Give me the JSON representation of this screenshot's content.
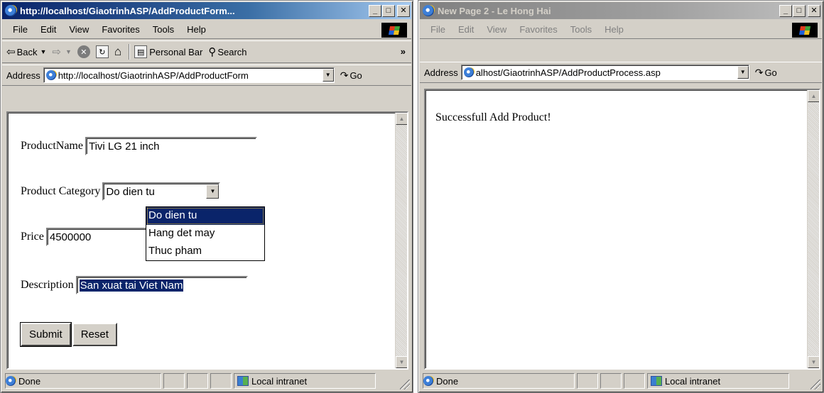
{
  "left_window": {
    "title": "http://localhost/GiaotrinhASP/AddProductForm...",
    "menu": [
      "File",
      "Edit",
      "View",
      "Favorites",
      "Tools",
      "Help"
    ],
    "toolbar": {
      "back_label": "Back",
      "personal_bar_label": "Personal Bar",
      "search_label": "Search"
    },
    "address": {
      "label": "Address",
      "value": "http://localhost/GiaotrinhASP/AddProductForm",
      "go_label": "Go"
    },
    "form": {
      "product_name_label": "ProductName",
      "product_name_value": "Tivi LG 21 inch",
      "category_label": "Product Category",
      "category_selected": "Do dien tu",
      "category_options": [
        "Do dien tu",
        "Hang det may",
        "Thuc pham"
      ],
      "price_label": "Price",
      "price_value": "4500000",
      "description_label": "Description",
      "description_value": "San xuat tai Viet Nam",
      "submit_label": "Submit",
      "reset_label": "Reset"
    },
    "status": {
      "text": "Done",
      "zone": "Local intranet"
    }
  },
  "right_window": {
    "title": "New Page 2 - Le Hong Hai",
    "menu": [
      "File",
      "Edit",
      "View",
      "Favorites",
      "Tools",
      "Help"
    ],
    "address": {
      "label": "Address",
      "value": "alhost/GiaotrinhASP/AddProductProcess.asp",
      "go_label": "Go"
    },
    "content": {
      "message": "Successfull Add Product!"
    },
    "status": {
      "text": "Done",
      "zone": "Local intranet"
    }
  },
  "colors": {
    "active_title": "#0a246a",
    "inactive_title": "#808080",
    "chrome": "#d4d0c8",
    "selection": "#0a246a"
  }
}
